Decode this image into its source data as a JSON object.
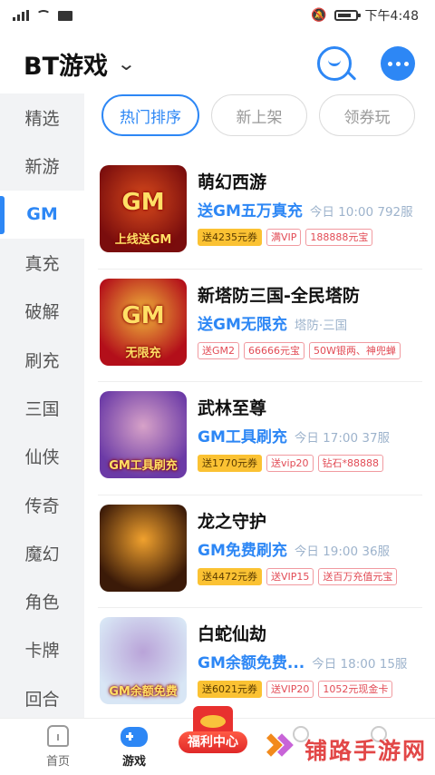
{
  "status": {
    "time": "下午4:48"
  },
  "header": {
    "title": "BT游戏"
  },
  "sidebar": {
    "items": [
      {
        "label": "精选"
      },
      {
        "label": "新游"
      },
      {
        "label": "GM"
      },
      {
        "label": "真充"
      },
      {
        "label": "破解"
      },
      {
        "label": "刷充"
      },
      {
        "label": "三国"
      },
      {
        "label": "仙侠"
      },
      {
        "label": "传奇"
      },
      {
        "label": "魔幻"
      },
      {
        "label": "角色"
      },
      {
        "label": "卡牌"
      },
      {
        "label": "回合"
      }
    ],
    "active": "GM"
  },
  "tabs": [
    {
      "label": "热门排序"
    },
    {
      "label": "新上架"
    },
    {
      "label": "领券玩"
    }
  ],
  "games": [
    {
      "name": "萌幻西游",
      "promo": "送GM五万真充",
      "meta": "今日 10:00 792服",
      "thumb_text": "GM",
      "thumb_sub": "上线送GM",
      "colors": [
        "#7a0d0d",
        "#d84a1c"
      ],
      "tags": [
        {
          "t": "送4235元券",
          "k": "gold"
        },
        {
          "t": "满VIP",
          "k": "red"
        },
        {
          "t": "188888元宝",
          "k": "red"
        }
      ]
    },
    {
      "name": "新塔防三国-全民塔防",
      "promo": "送GM无限充",
      "meta": "塔防·三国",
      "thumb_text": "GM",
      "thumb_sub": "无限充",
      "colors": [
        "#b30f1a",
        "#f0b53a"
      ],
      "tags": [
        {
          "t": "送GM2",
          "k": "red"
        },
        {
          "t": "66666元宝",
          "k": "red"
        },
        {
          "t": "50W银两、神兜蝉",
          "k": "red"
        }
      ]
    },
    {
      "name": "武林至尊",
      "promo": "GM工具刷充",
      "meta": "今日 17:00 37服",
      "thumb_text": "",
      "thumb_sub": "GM工具刷充",
      "colors": [
        "#6b3aa6",
        "#d7a2c8"
      ],
      "tags": [
        {
          "t": "送1770元券",
          "k": "gold"
        },
        {
          "t": "送vip20",
          "k": "red"
        },
        {
          "t": "钻石*88888",
          "k": "red"
        }
      ]
    },
    {
      "name": "龙之守护",
      "promo": "GM免费刷充",
      "meta": "今日 19:00 36服",
      "thumb_text": "",
      "thumb_sub": "",
      "colors": [
        "#3b1a08",
        "#f0a12e"
      ],
      "tags": [
        {
          "t": "送4472元券",
          "k": "gold"
        },
        {
          "t": "送VIP15",
          "k": "red"
        },
        {
          "t": "送百万充值元宝",
          "k": "red"
        }
      ]
    },
    {
      "name": "白蛇仙劫",
      "promo": "GM余额免费...",
      "meta": "今日 18:00 15服",
      "thumb_text": "",
      "thumb_sub": "GM余额免费",
      "colors": [
        "#d8e6f5",
        "#b9a3d8"
      ],
      "tags": [
        {
          "t": "送6021元券",
          "k": "gold"
        },
        {
          "t": "送VIP20",
          "k": "red"
        },
        {
          "t": "1052元现金卡",
          "k": "red"
        }
      ]
    }
  ],
  "bottom_nav": {
    "home": "首页",
    "games": "游戏",
    "welfare": "福利中心"
  },
  "watermark": "铺路手游网"
}
